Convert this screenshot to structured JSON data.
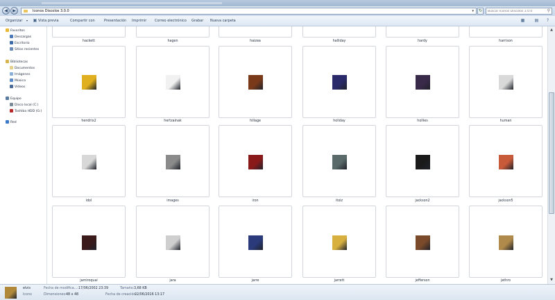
{
  "window": {
    "title": "Iconos Discolos 3.0.0"
  },
  "address": {
    "path": "Iconos Discolos 3.0.0",
    "search_placeholder": "Buscar Iconos Discolos 3.0.0"
  },
  "icons": {
    "back": "back-arrow-icon",
    "forward": "forward-arrow-icon",
    "refresh": "refresh-icon",
    "search": "search-icon",
    "folder": "folder-icon"
  },
  "toolbar": {
    "organize": "Organizar",
    "preview": "Vista previa",
    "share": "Compartir con",
    "presentation": "Presentación",
    "print": "Imprimir",
    "email": "Correo electrónico",
    "burn": "Grabar",
    "new_folder": "Nueva carpeta"
  },
  "sidebar": {
    "favorites": {
      "label": "Favoritos",
      "items": [
        {
          "label": "Descargas"
        },
        {
          "label": "Escritorio"
        },
        {
          "label": "Sitios recientes"
        }
      ]
    },
    "libraries": {
      "label": "Bibliotecas",
      "items": [
        {
          "label": "Documentos"
        },
        {
          "label": "Imágenes"
        },
        {
          "label": "Música"
        },
        {
          "label": "Vídeos"
        }
      ]
    },
    "computer": {
      "label": "Equipo",
      "items": [
        {
          "label": "Disco local (C:)"
        },
        {
          "label": "Toshiba HDD (G:)"
        }
      ]
    },
    "network": {
      "label": "Red"
    }
  },
  "files": {
    "row0": [
      {
        "name": "hackett"
      },
      {
        "name": "hagen"
      },
      {
        "name": "haizea"
      },
      {
        "name": "halliday"
      },
      {
        "name": "hardy"
      },
      {
        "name": "harrison"
      }
    ],
    "row1": [
      {
        "name": "hendrix2",
        "color": "#e0b020"
      },
      {
        "name": "hertzainak",
        "color": "#f1f1f1"
      },
      {
        "name": "hillage",
        "color": "#7a3a1a"
      },
      {
        "name": "holiday",
        "color": "#2a2a6a"
      },
      {
        "name": "hollies",
        "color": "#3a2a4a"
      },
      {
        "name": "human",
        "color": "#d9d9d9"
      }
    ],
    "row2": [
      {
        "name": "idol",
        "color": "#d8d8d8"
      },
      {
        "name": "images",
        "color": "#8a8a8a"
      },
      {
        "name": "iron",
        "color": "#8a1a1a"
      },
      {
        "name": "itoiz",
        "color": "#5a6a6a"
      },
      {
        "name": "jackson2",
        "color": "#1a1a1a"
      },
      {
        "name": "jackson5",
        "color": "#c85a3a"
      }
    ],
    "row3": [
      {
        "name": "jamiroquai",
        "color": "#3a1a1a"
      },
      {
        "name": "jara",
        "color": "#cfcfcf"
      },
      {
        "name": "jarre",
        "color": "#2a3a7a"
      },
      {
        "name": "jarrett",
        "color": "#d8b040"
      },
      {
        "name": "jefferson",
        "color": "#7a4a2a"
      },
      {
        "name": "jethro",
        "color": "#b08a4a"
      }
    ]
  },
  "details": {
    "name": "elvis",
    "type": "Icono",
    "modified_label": "Fecha de modifica...:",
    "modified_value": "17/06/2002 23:39",
    "dimensions_label": "Dimensiones:",
    "dimensions_value": "48 x 48",
    "size_label": "Tamaño:",
    "size_value": "3,68 KB",
    "created_label": "Fecha de creación:",
    "created_value": "22/06/2016 13:17",
    "thumb_color": "#b08a3a"
  }
}
